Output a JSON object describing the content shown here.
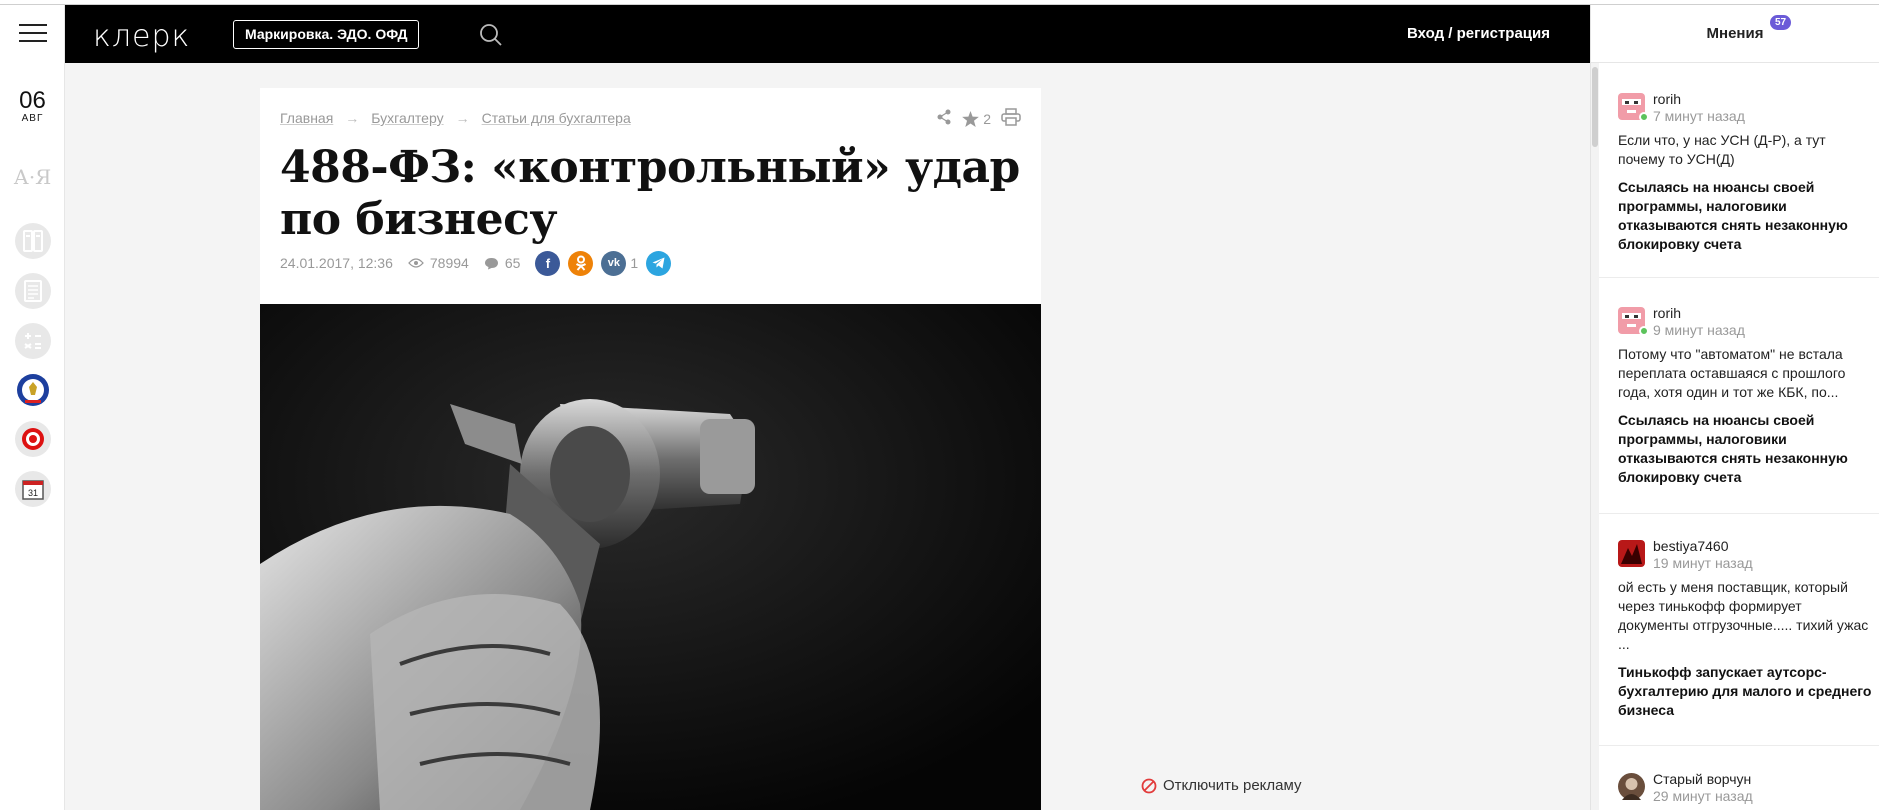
{
  "rail": {
    "day": "06",
    "month": "АВГ",
    "az_label": "А·Я"
  },
  "header": {
    "logo": "клерк",
    "brand_button": "Маркировка. ЭДО. ОФД",
    "login": "Вход / регистрация"
  },
  "opinions": {
    "title": "Мнения",
    "badge": "57",
    "comments": [
      {
        "user": "rorih",
        "time": "7 минут назад",
        "text": "Если что, у нас УСН (Д-Р), а тут почему то УСН(Д)",
        "link": "Ссылаясь на нюансы своей программы, налоговики отказываются снять незаконную блокировку счета"
      },
      {
        "user": "rorih",
        "time": "9 минут назад",
        "text": "Потому что \"автоматом\" не встала переплата оставшаяся с прошлого года, хотя один и тот же КБК, по...",
        "link": "Ссылаясь на нюансы своей программы, налоговики отказываются снять незаконную блокировку счета"
      },
      {
        "user": "bestiya7460",
        "time": "19 минут назад",
        "text": "ой есть у меня поставщик, который через тинькофф формирует документы отгрузочные..... тихий ужас ...",
        "link": "Тинькофф запускает аутсорс-бухгалтерию для малого и среднего бизнеса"
      },
      {
        "user": "Старый ворчун",
        "time": "29 минут назад",
        "text": "",
        "link": ""
      }
    ]
  },
  "article": {
    "breadcrumbs": [
      "Главная",
      "Бухгалтеру",
      "Статьи для бухгалтера"
    ],
    "favorites_count": "2",
    "title": "488-ФЗ: «контрольный» удар по бизнесу",
    "date": "24.01.2017, 12:36",
    "views": "78994",
    "comments": "65",
    "vk_count": "1"
  },
  "ads": {
    "disable_label": "Отключить рекламу"
  },
  "colors": {
    "accent_badge": "#6b5bd8",
    "facebook": "#3b5998",
    "odnoklassniki": "#ee8208",
    "vk": "#4c6f94",
    "telegram": "#2ca5e0"
  }
}
